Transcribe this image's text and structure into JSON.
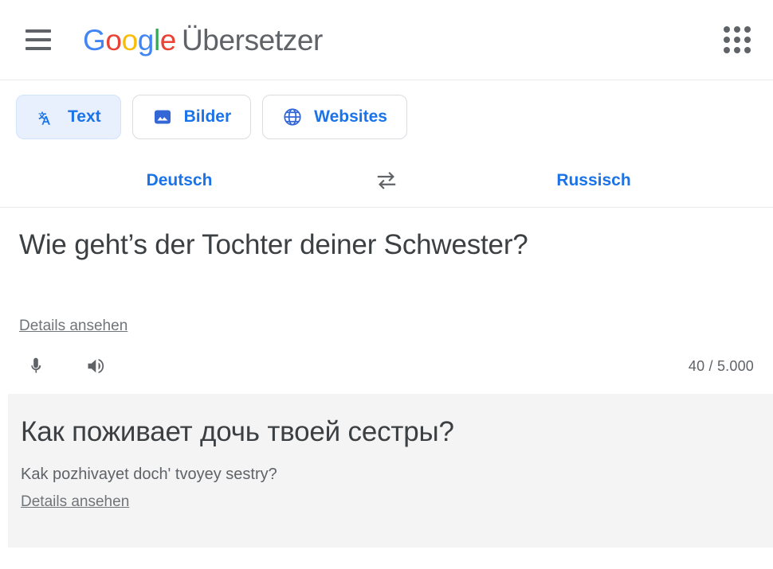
{
  "header": {
    "menu_icon": "hamburger-menu-icon",
    "logo_letters": [
      "G",
      "o",
      "o",
      "g",
      "l",
      "e"
    ],
    "product_name": "Übersetzer",
    "apps_icon": "apps-grid-icon"
  },
  "tabs": [
    {
      "label": "Text",
      "icon": "translate-icon",
      "active": true
    },
    {
      "label": "Bilder",
      "icon": "image-icon",
      "active": false
    },
    {
      "label": "Websites",
      "icon": "globe-icon",
      "active": false
    }
  ],
  "languages": {
    "source": "Deutsch",
    "target": "Russisch",
    "swap_icon": "swap-arrows-icon"
  },
  "source_panel": {
    "text": "Wie geht’s der Tochter deiner Schwester?",
    "details_label": "Details ansehen",
    "mic_icon": "microphone-icon",
    "speaker_icon": "speaker-icon",
    "counter": "40 / 5.000"
  },
  "translation_panel": {
    "text": "Как поживает дочь твоей сестры?",
    "transliteration": "Kak pozhivayet doch' tvoyey sestry?",
    "details_label": "Details ansehen"
  },
  "colors": {
    "google_blue": "#4285f4",
    "google_red": "#ea4335",
    "google_yellow": "#fbbc05",
    "google_green": "#34a853",
    "accent_blue": "#1a73e8",
    "tab_active_bg": "#e8f0fe",
    "panel_gray": "#f4f4f4",
    "text_gray": "#3c4043",
    "muted_gray": "#5f6368"
  }
}
